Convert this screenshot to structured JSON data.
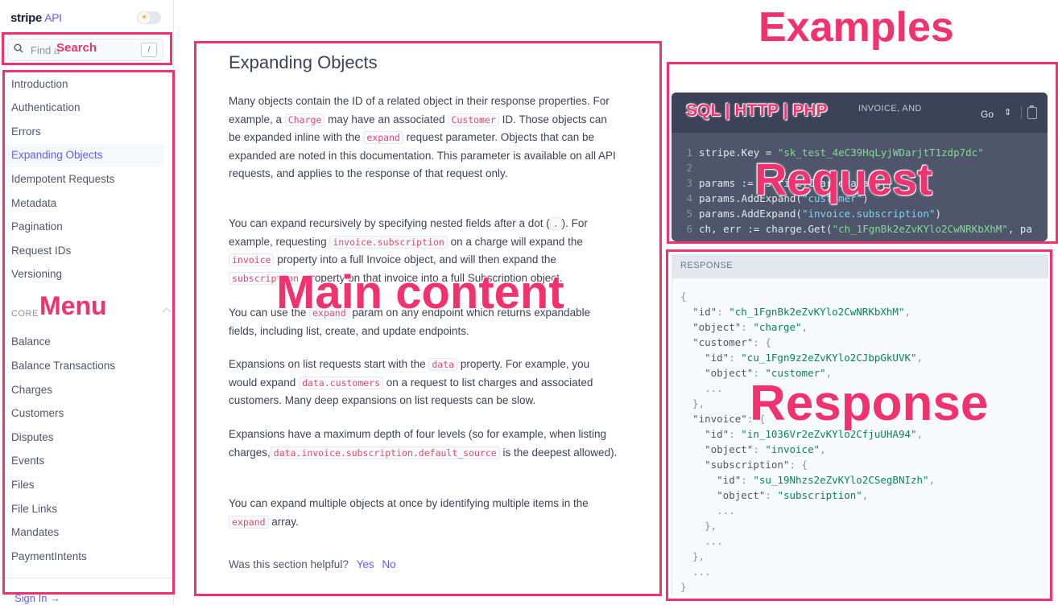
{
  "sidebar": {
    "brand": "stripe",
    "brand_suffix": "API",
    "search_placeholder": "Find a",
    "search_shortcut": "/",
    "items": [
      "Introduction",
      "Authentication",
      "Errors",
      "Expanding Objects",
      "Idempotent Requests",
      "Metadata",
      "Pagination",
      "Request IDs",
      "Versioning"
    ],
    "active_item": "Expanding Objects",
    "core_heading": "CORE",
    "core_items": [
      "Balance",
      "Balance Transactions",
      "Charges",
      "Customers",
      "Disputes",
      "Events",
      "Files",
      "File Links",
      "Mandates",
      "PaymentIntents"
    ],
    "sign_in": "Sign In →"
  },
  "main": {
    "title": "Expanding Objects",
    "helpful_question": "Was this section helpful?",
    "helpful_yes": "Yes",
    "helpful_no": "No"
  },
  "request": {
    "header_text": "INVOICE, AND",
    "language": "Go",
    "lines": [
      {
        "n": "1",
        "code": "stripe.Key = ",
        "str": "\"sk_test_4eC39HqLyjWDarjtT1zdp7dc\""
      },
      {
        "n": "2",
        "code": "",
        "str": ""
      },
      {
        "n": "3",
        "code": "params := &stripe.ChargeParams{}",
        "str": ""
      },
      {
        "n": "4",
        "code": "params.AddExpand(",
        "str": "\"customer\"",
        "tail": ")"
      },
      {
        "n": "5",
        "code": "params.AddExpand(",
        "str": "\"invoice.subscription\"",
        "tail": ")"
      },
      {
        "n": "6",
        "code": "ch, err := charge.Get(",
        "str": "\"ch_1FgnBk2eZvKYlo2CwNRKbXhM\"",
        "tail": ", pa"
      }
    ]
  },
  "response": {
    "heading": "RESPONSE"
  },
  "annotations": {
    "examples": "Examples",
    "search": "Search",
    "menu": "Menu",
    "main_content": "Main content",
    "languages": "SQL | HTTP | PHP",
    "request": "Request",
    "response": "Response"
  },
  "colors": {
    "annotation": "#f0326e",
    "accent": "#635bff",
    "code_string": "#09825d"
  }
}
